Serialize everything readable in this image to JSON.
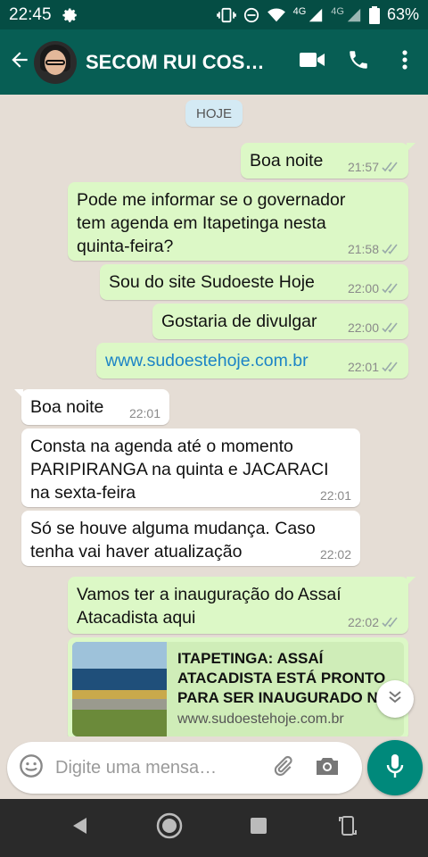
{
  "status_bar": {
    "time": "22:45",
    "battery": "63%",
    "network_1": "4G",
    "network_2": "4G"
  },
  "header": {
    "contact_name": "SECOM RUI COS…"
  },
  "chat": {
    "date_chip": "HOJE",
    "messages": [
      {
        "dir": "out",
        "text": "Boa noite",
        "time": "21:57"
      },
      {
        "dir": "out",
        "lines": [
          "Pode me informar se o governador",
          "tem agenda em Itapetinga nesta",
          "quinta-feira?"
        ],
        "time": "21:58"
      },
      {
        "dir": "out",
        "text": "Sou do site Sudoeste Hoje",
        "time": "22:00"
      },
      {
        "dir": "out",
        "text": "Gostaria de divulgar",
        "time": "22:00"
      },
      {
        "dir": "out",
        "text": "www.sudoestehoje.com.br",
        "time": "22:01"
      },
      {
        "dir": "in",
        "text": "Boa noite",
        "time": "22:01"
      },
      {
        "dir": "in",
        "lines": [
          "Consta na agenda até o momento",
          "PARIPIRANGA na quinta e JACARACI",
          "na sexta-feira"
        ],
        "time": "22:01"
      },
      {
        "dir": "in",
        "lines": [
          "Só se houve alguma mudança. Caso",
          "tenha vai haver atualização"
        ],
        "time": "22:02"
      },
      {
        "dir": "out",
        "lines": [
          "Vamos ter a inauguração do Assaí",
          "Atacadista aqui"
        ],
        "time": "22:02"
      }
    ],
    "link_preview": {
      "title": "ITAPETINGA: ASSAÍ ATACADISTA ESTÁ PRONTO PARA SER INAUGURADO N…",
      "site": "www.sudoestehoje.com.br"
    }
  },
  "composer": {
    "placeholder": "Digite uma mensa…"
  },
  "colors": {
    "header": "#075e54",
    "status": "#054d44",
    "outgoing": "#dcf8c6",
    "incoming": "#ffffff",
    "accent": "#00897b",
    "link": "#1c84c6"
  },
  "icons": [
    "settings-icon",
    "vibrate-icon",
    "dnd-icon",
    "wifi-icon",
    "signal-icon",
    "battery-icon",
    "back-arrow-icon",
    "video-call-icon",
    "phone-icon",
    "more-icon",
    "read-ticks-icon",
    "scroll-down-icon",
    "emoji-icon",
    "attach-icon",
    "camera-icon",
    "mic-icon",
    "nav-back-icon",
    "nav-home-icon",
    "nav-recents-icon",
    "rotate-icon"
  ]
}
